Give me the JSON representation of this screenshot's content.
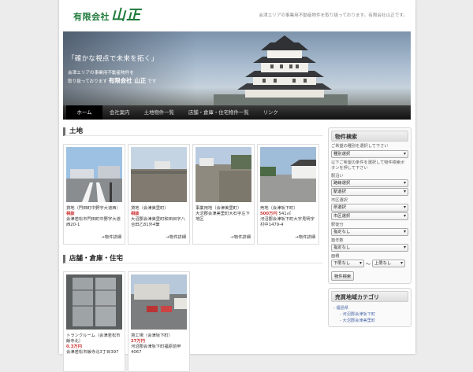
{
  "site": {
    "logo_small": "有限会社",
    "logo_big": "山正",
    "tagline": "会津エリアの事業用不動産物件を取り扱っております。有限会社山正です。"
  },
  "hero": {
    "line1": "「確かな視点で未来を拓く」",
    "line2": "会津エリアの事業用不動産物件を",
    "line3": "取り扱っております",
    "line3_bold": "有限会社 山正",
    "line3_end": "です"
  },
  "nav": [
    "ホーム",
    "会社案内",
    "土地物件一覧",
    "店舗・倉庫・住宅物件一覧",
    "リンク"
  ],
  "land": {
    "title": "土地",
    "cards": [
      {
        "type": "貸地（門田町中野字大道西）",
        "price": "相談",
        "area": "",
        "addr": "会津若松市門田町中野字大道西20-1",
        "more": "→物件詳細"
      },
      {
        "type": "貸地（会津美里町）",
        "price": "相談",
        "area": "",
        "addr": "大沼郡会津美里町和田目字八合田乙81外4筆",
        "more": "→物件詳細"
      },
      {
        "type": "事業用地（会津美里町）",
        "price": "",
        "area": "",
        "addr": "大沼郡会津美里町大石字左下地区",
        "more": "→物件詳細"
      },
      {
        "type": "売地（会津坂下町）",
        "price": "500万円",
        "area": "541㎡",
        "addr": "河沼郡会津坂下町大字見明字村中1479-4",
        "more": "→物件詳細"
      }
    ]
  },
  "shop": {
    "title": "店舗・倉庫・住宅",
    "cards": [
      {
        "type": "トランクルーム（会津若松市飯寺北）",
        "price": "0.3万円",
        "area": "",
        "addr": "会津若松市飯寺北3丁目397"
      },
      {
        "type": "貸工場（会津坂下町）",
        "price": "27万円",
        "area": "",
        "addr": "河沼郡会津坂下町福原前甲4067"
      }
    ]
  },
  "search": {
    "title": "物件検索",
    "intro": "ご希望の種別を選択して下さい",
    "kind": "種別選択",
    "intro2": "以下ご希望の条件を選択して物件検索ボタンを押して下さい",
    "eki_label": "駅沿い",
    "line_sel": "路線選択",
    "station_sel": "駅選択",
    "city_label": "市区選択",
    "pref_sel": "県選択",
    "city_sel": "市区選択",
    "walk_label": "駅徒分",
    "walk_sel": "指定なし",
    "age_label": "築年数",
    "age_sel": "指定なし",
    "size_label": "面積",
    "size_min": "下限なし",
    "size_sep": "〜",
    "size_max": "上限なし",
    "button": "物件検索"
  },
  "area_box": {
    "title": "売買地域カテゴリ",
    "items": [
      "福島県",
      "河沼郡会津坂下町",
      "大沼郡会津美里町"
    ]
  }
}
